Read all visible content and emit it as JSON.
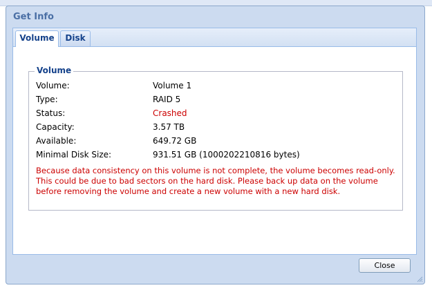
{
  "dialog": {
    "title": "Get Info",
    "close_label": "Close"
  },
  "tabs": [
    {
      "label": "Volume",
      "active": true
    },
    {
      "label": "Disk",
      "active": false
    }
  ],
  "volume": {
    "legend": "Volume",
    "rows": [
      {
        "label": "Volume:",
        "value": "Volume 1"
      },
      {
        "label": "Type:",
        "value": "RAID 5"
      },
      {
        "label": "Status:",
        "value": "Crashed"
      },
      {
        "label": "Capacity:",
        "value": "3.57 TB"
      },
      {
        "label": "Available:",
        "value": "649.72 GB"
      },
      {
        "label": "Minimal Disk Size:",
        "value": "931.51 GB (1000202210816 bytes)"
      }
    ],
    "warning": "Because data consistency on this volume is not complete, the volume becomes read-only. This could be due to bad sectors on the hard disk. Please back up data on the volume before removing the volume and create a new volume with a new hard disk."
  },
  "colors": {
    "status_crashed": "#cc0000",
    "tab_text": "#15428b",
    "title_text": "#4a6fa5"
  }
}
